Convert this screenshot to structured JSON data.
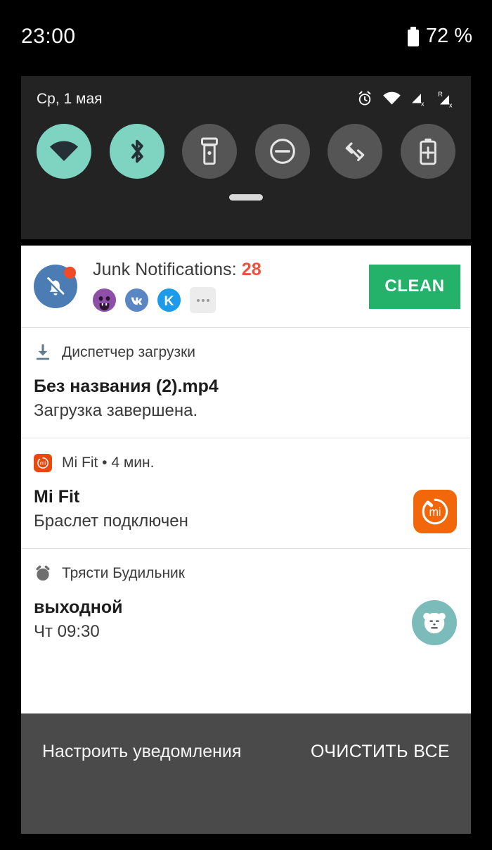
{
  "status_bar": {
    "clock": "23:00",
    "battery_percent": "72 %",
    "battery_icon": "battery-icon"
  },
  "quick_settings": {
    "date": "Ср, 1 мая",
    "status_icons": [
      "alarm-icon",
      "wifi-icon",
      "signal-no-service-icon",
      "signal-roaming-no-service-icon"
    ],
    "roaming_label": "R",
    "tiles": [
      {
        "name": "wifi",
        "icon": "wifi-icon",
        "active": true
      },
      {
        "name": "bluetooth",
        "icon": "bluetooth-icon",
        "active": true
      },
      {
        "name": "flashlight",
        "icon": "flashlight-icon",
        "active": false
      },
      {
        "name": "do-not-disturb",
        "icon": "do-not-disturb-icon",
        "active": false
      },
      {
        "name": "auto-rotate",
        "icon": "auto-rotate-icon",
        "active": false
      },
      {
        "name": "battery-saver",
        "icon": "battery-saver-icon",
        "active": false
      }
    ],
    "colors": {
      "active": "#7FD4C1",
      "inactive": "#555555",
      "panel_bg": "#232323"
    }
  },
  "junk_card": {
    "title_text": "Junk Notifications: ",
    "count": "28",
    "count_color": "#F0503A",
    "icon": "bell-off-icon",
    "badge": "red-dot-badge",
    "apps": [
      {
        "name": "app-avatar-monster",
        "label": ""
      },
      {
        "name": "app-avatar-vk",
        "label": "VK"
      },
      {
        "name": "app-avatar-kate",
        "label": "K"
      }
    ],
    "more_label": "...",
    "button_label": "CLEAN",
    "button_color": "#24B26B"
  },
  "notifications": [
    {
      "app_name": "Диспетчер загрузки",
      "app_icon": "download-icon",
      "title": "Без названия (2).mp4",
      "body": "Загрузка завершена.",
      "time": "",
      "big_icon": ""
    },
    {
      "app_name": "Mi Fit",
      "app_icon": "mi-fit-icon",
      "separator": " • ",
      "time": "4 мин.",
      "title": "Mi Fit",
      "body": "Браслет подключен",
      "big_icon": "mi-fit-large-icon"
    },
    {
      "app_name": "Трясти Будильник",
      "app_icon": "alarm-clock-icon",
      "title": "выходной",
      "body": "Чт 09:30",
      "time": "",
      "big_icon": "bear-avatar-icon"
    }
  ],
  "footer": {
    "manage_label": "Настроить уведомления",
    "clear_all_label": "ОЧИСТИТЬ ВСЕ"
  }
}
